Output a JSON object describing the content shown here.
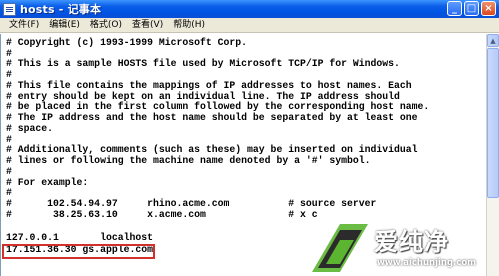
{
  "window": {
    "title": "hosts - 记事本",
    "buttons": {
      "minimize": "_",
      "maximize": "□",
      "close": "×"
    }
  },
  "menu": {
    "items": [
      "文件(F)",
      "编辑(E)",
      "格式(O)",
      "查看(V)",
      "帮助(H)"
    ]
  },
  "editor": {
    "lines": [
      "# Copyright (c) 1993-1999 Microsoft Corp.",
      "#",
      "# This is a sample HOSTS file used by Microsoft TCP/IP for Windows.",
      "#",
      "# This file contains the mappings of IP addresses to host names. Each",
      "# entry should be kept on an individual line. The IP address should",
      "# be placed in the first column followed by the corresponding host name.",
      "# The IP address and the host name should be separated by at least one",
      "# space.",
      "#",
      "# Additionally, comments (such as these) may be inserted on individual",
      "# lines or following the machine name denoted by a '#' symbol.",
      "#",
      "# For example:",
      "#",
      "#      102.54.94.97     rhino.acme.com          # source server",
      "#       38.25.63.10     x.acme.com              # x c",
      "",
      "127.0.0.1       localhost",
      "17.151.36.30 gs.apple.com"
    ]
  },
  "scrollbar": {
    "up_arrow": "▲"
  },
  "watermark": {
    "text": "爱纯净",
    "url": "www.aichunjing.com",
    "colors": {
      "logo_green": "#5bb531",
      "logo_dark": "#2b2b2b"
    }
  },
  "highlight": {
    "color": "#d2302b"
  }
}
